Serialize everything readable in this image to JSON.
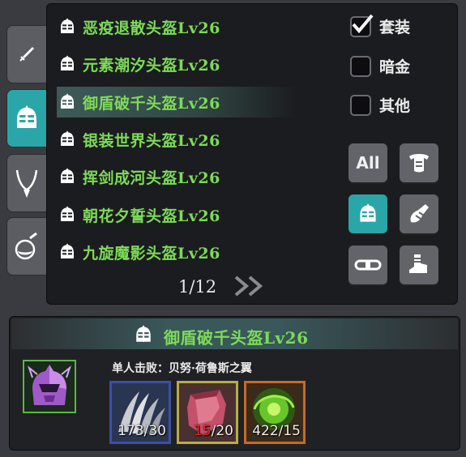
{
  "category_tabs": [
    {
      "name": "sword",
      "icon": "sword-icon",
      "active": false
    },
    {
      "name": "helmet",
      "icon": "helmet-icon",
      "active": true
    },
    {
      "name": "necklace",
      "icon": "necklace-icon",
      "active": false
    },
    {
      "name": "potion",
      "icon": "potion-icon",
      "active": false
    }
  ],
  "items": [
    {
      "label": "恶疫退散头盔Lv26",
      "selected": false
    },
    {
      "label": "元素潮汐头盔Lv26",
      "selected": false
    },
    {
      "label": "御盾破千头盔Lv26",
      "selected": true
    },
    {
      "label": "银装世界头盔Lv26",
      "selected": false
    },
    {
      "label": "挥剑成河头盔Lv26",
      "selected": false
    },
    {
      "label": "朝花夕誓头盔Lv26",
      "selected": false
    },
    {
      "label": "九旋魔影头盔Lv26",
      "selected": false
    }
  ],
  "filters": [
    {
      "label": "套装",
      "checked": true
    },
    {
      "label": "暗金",
      "checked": false
    },
    {
      "label": "其他",
      "checked": false
    }
  ],
  "slot_buttons": [
    {
      "label": "All",
      "icon": "",
      "active": false
    },
    {
      "label": "",
      "icon": "armor-icon",
      "active": false
    },
    {
      "label": "",
      "icon": "helmet-icon",
      "active": true
    },
    {
      "label": "",
      "icon": "arm-guard-icon",
      "active": false
    },
    {
      "label": "",
      "icon": "belt-icon",
      "active": false
    },
    {
      "label": "",
      "icon": "boots-icon",
      "active": false
    }
  ],
  "pagination": {
    "text": "1/12"
  },
  "detail": {
    "title": "御盾破千头盔Lv26",
    "kill_requirement": "单人击败：贝努·荷鲁斯之翼",
    "materials": [
      {
        "icon": "claw-icon",
        "have": "173",
        "need": "/30",
        "short": false,
        "border": "#3b4fa8",
        "bg": "#2a3550"
      },
      {
        "icon": "cloth-icon",
        "have": "15",
        "need": "/20",
        "short": true,
        "border": "#b8ab4a",
        "bg": "#4a3030"
      },
      {
        "icon": "green-orb-icon",
        "have": "422",
        "need": "/15",
        "short": false,
        "border": "#c56a2a",
        "bg": "#3a2a1a"
      }
    ]
  }
}
